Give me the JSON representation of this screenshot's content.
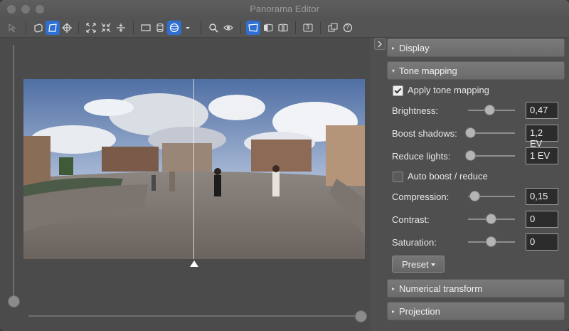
{
  "window": {
    "title": "Panorama Editor"
  },
  "toolbar": {
    "icons": [
      "pointer-icon",
      "perspective-plane-icon",
      "freeform-plane-icon",
      "center-target-icon",
      "fit-expand-icon",
      "fit-compress-icon",
      "split-vertical-icon",
      "rectangle-projection-icon",
      "cylinder-projection-icon",
      "sphere-projection-icon",
      "dropdown-arrow-icon",
      "magnifier-icon",
      "eye-icon",
      "view-plane-icon",
      "view-cube-icon",
      "view-book-icon",
      "number-3-icon",
      "windows-icon",
      "help-icon"
    ],
    "number_label": "3",
    "help_label": "?"
  },
  "panel": {
    "display": {
      "label": "Display"
    },
    "tone_mapping": {
      "label": "Tone mapping",
      "apply_label": "Apply tone mapping",
      "apply_checked": true,
      "brightness": {
        "label": "Brightness:",
        "value": "0,47",
        "level": 0.47
      },
      "boost_shadows": {
        "label": "Boost shadows:",
        "value": "1,2 EV",
        "level": 0.0
      },
      "reduce_lights": {
        "label": "Reduce lights:",
        "value": "1 EV",
        "level": 0.0
      },
      "auto_label": "Auto boost / reduce",
      "auto_checked": false,
      "compression": {
        "label": "Compression:",
        "value": "0,15",
        "level": 0.15
      },
      "contrast": {
        "label": "Contrast:",
        "value": "0",
        "level": 0.5
      },
      "saturation": {
        "label": "Saturation:",
        "value": "0",
        "level": 0.5
      },
      "preset_label": "Preset"
    },
    "numerical_transform": {
      "label": "Numerical transform"
    },
    "projection": {
      "label": "Projection"
    }
  },
  "colors": {
    "accent": "#2f6fd0",
    "window_bg": "#4f4f4f"
  }
}
